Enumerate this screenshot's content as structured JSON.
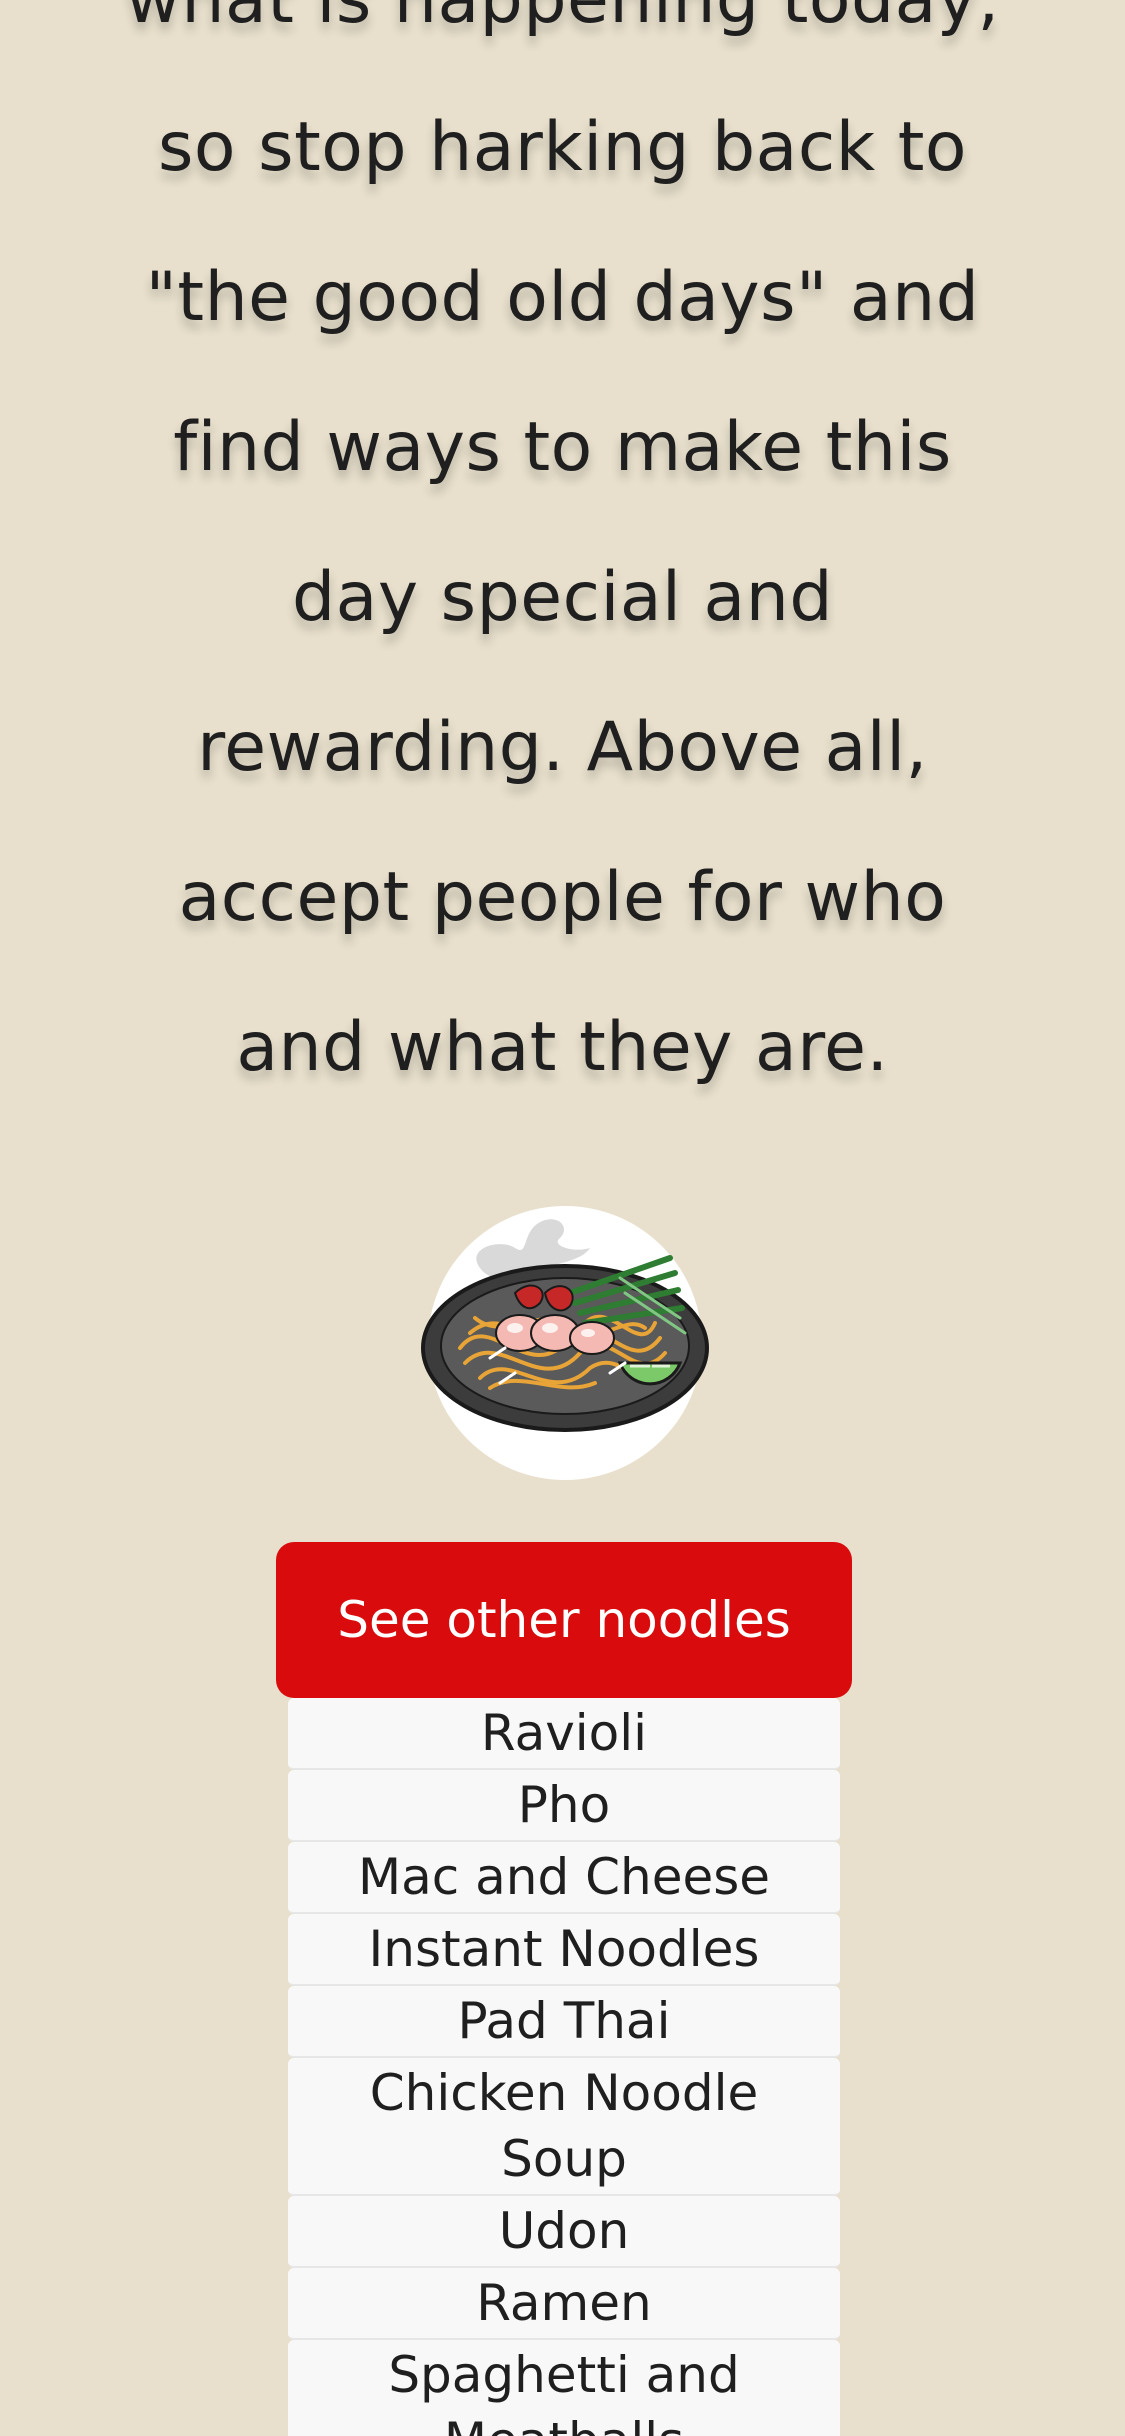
{
  "quote": {
    "lines": [
      "what is happening today,",
      "so stop harking back to",
      "\"the good old days\" and",
      "find ways to make this",
      "day special and",
      "rewarding. Above all,",
      "accept people for who",
      "and what they are."
    ]
  },
  "dish_image": {
    "icon": "pad-thai-plate-icon"
  },
  "see_other_button": {
    "label": "See other noodles",
    "color": "#d90b0c"
  },
  "noodle_list": {
    "items": [
      "Ravioli",
      "Pho",
      "Mac and Cheese",
      "Instant Noodles",
      "Pad Thai",
      "Chicken Noodle Soup",
      "Udon",
      "Ramen",
      "Spaghetti and Meatballs"
    ]
  },
  "colors": {
    "background": "#e8e0cc",
    "button": "#d90b0c",
    "list_item_bg": "#f8f8f8"
  }
}
